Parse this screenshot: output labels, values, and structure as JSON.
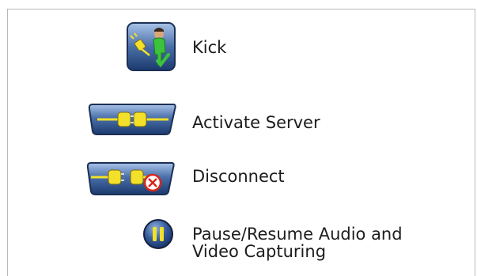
{
  "legend": {
    "items": [
      {
        "id": "kick",
        "label": "Kick",
        "icon": "kick-user-icon"
      },
      {
        "id": "activate-server",
        "label": "Activate Server",
        "icon": "plug-connected-icon"
      },
      {
        "id": "disconnect",
        "label": "Disconnect",
        "icon": "plug-disconnected-icon"
      },
      {
        "id": "pause-resume",
        "label_line1": "Pause/Resume Audio and",
        "label_line2": "Video Capturing",
        "icon": "pause-icon"
      }
    ]
  },
  "colors": {
    "icon_dark_blue": "#1f3f78",
    "icon_light_blue": "#8fb0dc",
    "plug_yellow": "#f2e02a",
    "person_green": "#3cc23c",
    "disconnect_red": "#d8261c",
    "border": "#b9b9b9",
    "text": "#1c1c1c"
  }
}
